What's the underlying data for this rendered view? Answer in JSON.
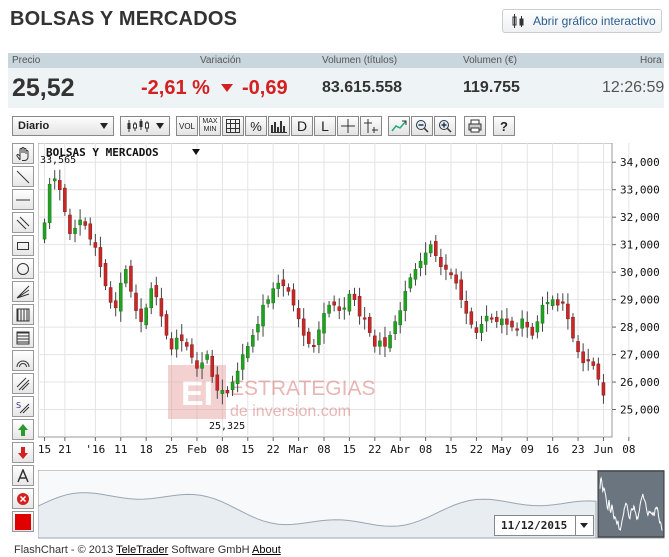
{
  "header": {
    "title": "BOLSAS Y MERCADOS",
    "open_chart_label": "Abrir gráfico interactivo"
  },
  "quote": {
    "labels": {
      "price": "Precio",
      "change": "Variación",
      "volume_titles": "Volumen (títulos)",
      "volume_eur": "Volumen (€)",
      "time": "Hora"
    },
    "price": "25,52",
    "change_pct": "-2,61 %",
    "change_abs": "-0,69",
    "volume_titles": "83.615.558",
    "volume_eur": "119.755",
    "time": "12:26:59",
    "colors": {
      "negative": "#d42020",
      "header_bg": "#c9d6dd",
      "values_bg": "#eef3f6"
    }
  },
  "toolbar": {
    "period": "Diario",
    "vol": "VOL",
    "max": "MAX",
    "min": "MIN",
    "pct": "%",
    "d": "D",
    "l": "L",
    "help": "?"
  },
  "chart": {
    "instrument_label": "BOLSAS Y MERCADOS",
    "high_label": "33,565",
    "low_label": "25,325",
    "watermark_logo": "EI",
    "watermark_line1": "ESTRATEGIAS",
    "watermark_line2": "de inversion.com"
  },
  "chart_data": {
    "type": "candlestick",
    "ylim": [
      24000,
      34700
    ],
    "y_ticks": [
      "25,000",
      "26,000",
      "27,000",
      "28,000",
      "29,000",
      "30,000",
      "31,000",
      "32,000",
      "33,000",
      "34,000"
    ],
    "y_tick_values": [
      25000,
      26000,
      27000,
      28000,
      29000,
      30000,
      31000,
      32000,
      33000,
      34000
    ],
    "x_ticks": [
      "15",
      "21",
      "'16",
      "11",
      "18",
      "25",
      "Feb",
      "08",
      "15",
      "22",
      "Mar",
      "08",
      "15",
      "22",
      "Abr",
      "08",
      "15",
      "22",
      "May",
      "09",
      "16",
      "23",
      "Jun",
      "08"
    ],
    "x_tick_index": [
      0,
      4,
      10,
      15,
      20,
      25,
      30,
      35,
      40,
      45,
      50,
      55,
      60,
      65,
      70,
      75,
      80,
      85,
      90,
      95,
      100,
      105,
      110,
      115
    ],
    "close": [
      31800,
      33200,
      33400,
      33000,
      32200,
      31400,
      31600,
      31900,
      31700,
      31200,
      30900,
      30200,
      29500,
      28900,
      28700,
      29600,
      30100,
      29300,
      28600,
      28200,
      28700,
      29400,
      29100,
      28400,
      27700,
      27200,
      27600,
      27500,
      27300,
      26900,
      26500,
      26700,
      27000,
      26200,
      25700,
      25700,
      25600,
      26000,
      26400,
      27000,
      27300,
      27700,
      28100,
      28800,
      29000,
      29400,
      29600,
      29500,
      29300,
      28800,
      28300,
      27700,
      27400,
      27300,
      27900,
      28500,
      28800,
      28800,
      28600,
      28700,
      29200,
      29000,
      28400,
      28300,
      27800,
      27300,
      27500,
      27300,
      27700,
      28200,
      28600,
      29300,
      29800,
      30100,
      30400,
      30700,
      31000,
      30600,
      30200,
      30100,
      29900,
      29600,
      29000,
      28500,
      28100,
      27800,
      28100,
      28400,
      28300,
      28200,
      28300,
      28100,
      28000,
      27900,
      28300,
      28000,
      27700,
      28200,
      28800,
      28900,
      29000,
      28800,
      28900,
      28300,
      27600,
      27100,
      26700,
      26800,
      26600,
      26100,
      25520
    ],
    "high_value": 33565,
    "low_value": 25325
  },
  "navigator": {
    "date": "11/12/2015"
  },
  "footer": {
    "prefix": "FlashChart - © 2013 ",
    "company": "TeleTrader",
    "mid": " Software GmbH ",
    "about": "About"
  }
}
